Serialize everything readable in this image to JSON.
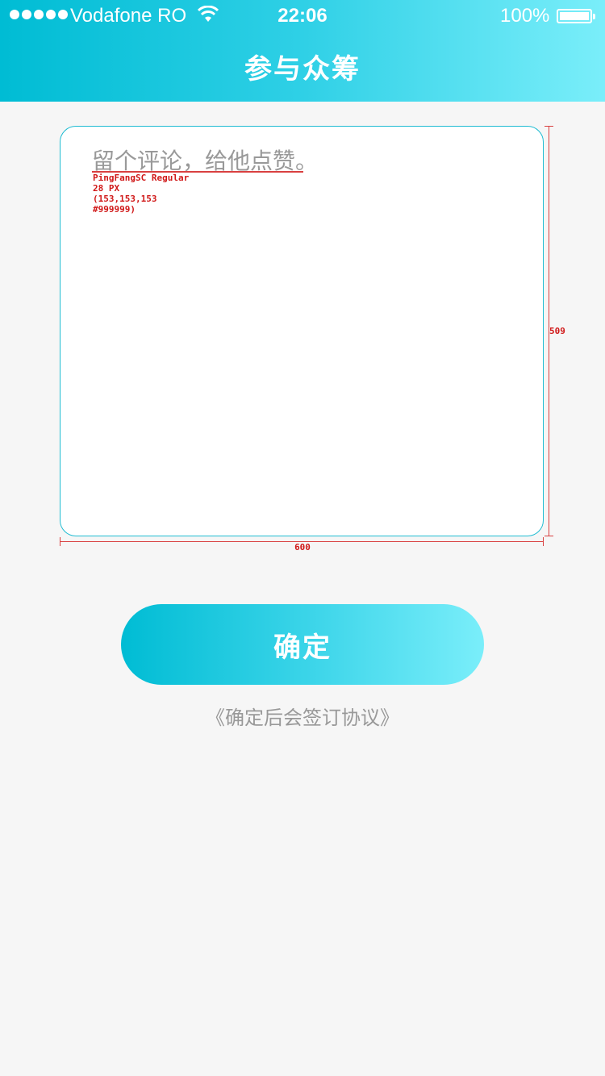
{
  "status_bar": {
    "carrier": "Vodafone RO",
    "time": "22:06",
    "battery": "100%"
  },
  "header": {
    "title": "参与众筹"
  },
  "comment": {
    "placeholder": "留个评论，给他点赞。",
    "value": ""
  },
  "annotations": {
    "font_spec": [
      "PingFangSC Regular",
      "28 PX",
      "(153,153,153",
      "#999999)"
    ],
    "box_height": "509",
    "box_width": "600"
  },
  "actions": {
    "confirm_label": "确定",
    "agreement_text": "《确定后会签订协议》"
  },
  "colors": {
    "brand_start": "#00bcd4",
    "brand_end": "#7aeefa",
    "placeholder": "#999999",
    "annotation": "#d01818"
  }
}
